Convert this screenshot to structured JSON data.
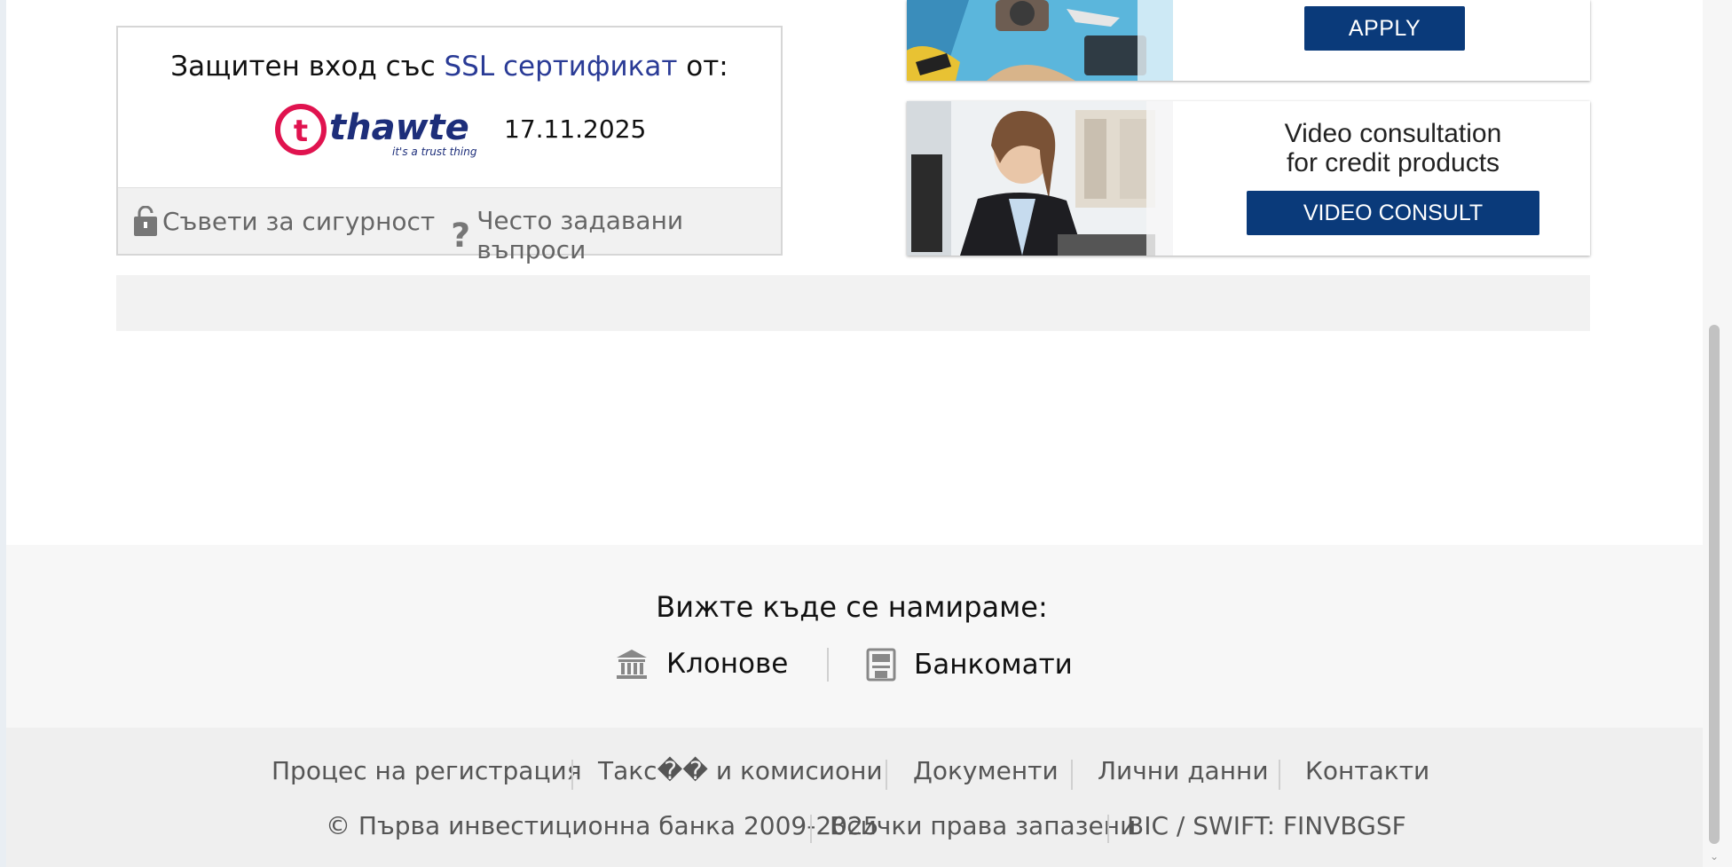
{
  "ssl": {
    "title_prefix": "Защитен вход със ",
    "title_link": "SSL сертификат",
    "title_suffix": " от:",
    "logo_name": "thawte",
    "logo_tagline": "it's a trust thing",
    "date": "17.11.2025",
    "security_tips": "Съвети за сигурност",
    "faq": "Често задавани въпроси"
  },
  "banners": {
    "apply_label": "APPLY",
    "video_title_line1": "Video consultation",
    "video_title_line2": "for credit products",
    "video_button": "VIDEO CONSULT"
  },
  "footer": {
    "find_us": "Вижте къде се намираме:",
    "branches": "Клонове",
    "atms": "Банкомати",
    "links": [
      "Процес на регистрация",
      "Такс�� и комисиони",
      "Документи",
      "Лични данни",
      "Контакти"
    ],
    "copyright": "© Първа инвестиционна банка 2009-2025",
    "rights": "Всички права запазени",
    "bic": "BIC / SWIFT: FINVBGSF"
  },
  "colors": {
    "brand_blue": "#0a3a7a",
    "link_blue": "#2a3b96",
    "thawte_red": "#e0134f",
    "thawte_navy": "#1d2e7a"
  }
}
